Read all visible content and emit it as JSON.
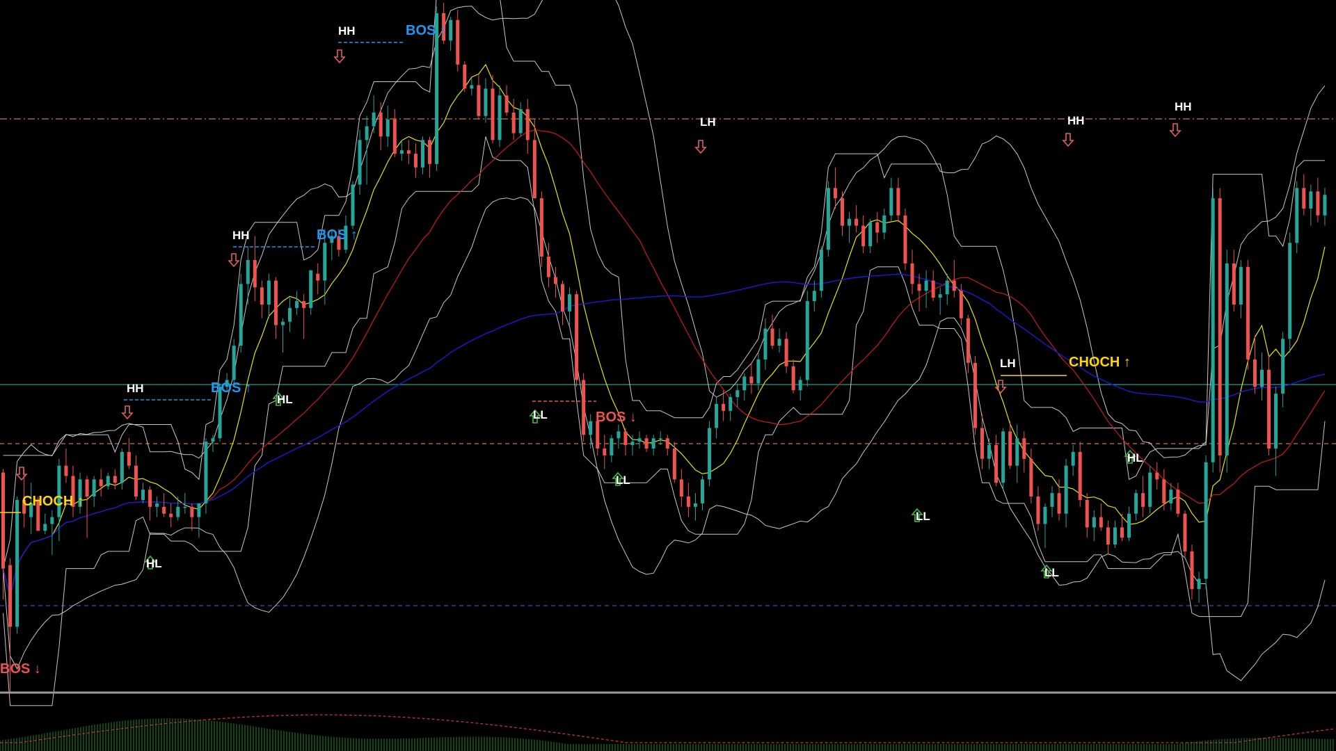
{
  "colors": {
    "background": "#000000",
    "bull": "#26a69a",
    "bear": "#ef5350",
    "bos_up": "#2196f3",
    "bos_down": "#ef5350",
    "choch": "#ffd600",
    "swing_label": "#ffffff",
    "bb": "#c8c8c8",
    "ma_fast": "#e6e600",
    "ma_mid": "#d01818",
    "ma_slow": "#1a1ad8",
    "hl_teal": "#2a9a8a",
    "hl_orange": "#c8783c",
    "hl_blue": "#3c50b4",
    "arrow_down": "#e06060",
    "arrow_up": "#40c040",
    "osc_hist": "#1e8c1e",
    "osc_line": "#c83232",
    "separator": "#9a9a9a"
  },
  "chart_data": {
    "type": "candlestick",
    "main_panel": {
      "price_range": [
        0,
        100
      ],
      "bar_count": 190,
      "candles": [
        [
          65,
          66,
          28,
          37
        ],
        [
          38,
          40,
          1,
          20
        ],
        [
          20,
          58,
          18,
          57
        ],
        [
          57,
          66,
          49,
          53
        ],
        [
          52,
          62,
          47,
          56
        ],
        [
          57,
          58,
          48,
          48
        ],
        [
          48,
          53,
          47,
          50
        ],
        [
          50,
          54,
          41,
          52
        ],
        [
          52,
          69,
          45,
          67
        ],
        [
          67,
          72,
          62,
          64
        ],
        [
          64,
          67,
          52,
          55
        ],
        [
          55,
          65,
          53,
          63
        ],
        [
          63,
          64,
          46,
          58
        ],
        [
          58,
          64,
          55,
          63
        ],
        [
          63,
          66,
          58,
          61
        ],
        [
          61,
          65,
          60,
          64
        ],
        [
          64,
          66,
          60,
          62
        ],
        [
          62,
          72,
          60,
          71
        ],
        [
          71,
          75,
          66,
          67
        ],
        [
          67,
          70,
          57,
          58
        ],
        [
          57,
          62,
          56,
          60
        ],
        [
          60,
          61,
          51,
          55
        ],
        [
          55,
          58,
          52,
          56
        ],
        [
          55,
          59,
          52,
          53
        ],
        [
          53,
          56,
          49,
          52
        ],
        [
          52,
          58,
          51,
          55
        ],
        [
          55,
          59,
          53,
          55
        ],
        [
          55,
          56,
          48,
          52
        ],
        [
          52,
          56,
          46,
          56
        ],
        [
          56,
          75,
          53,
          74
        ],
        [
          74,
          76,
          71,
          75
        ],
        [
          75,
          91,
          74,
          90
        ],
        [
          90,
          94,
          89,
          92
        ],
        [
          92,
          104,
          90,
          102
        ],
        [
          102,
          123,
          100,
          120
        ],
        [
          120,
          131,
          114,
          127
        ],
        [
          127,
          134,
          115,
          119
        ],
        [
          119,
          121,
          110,
          114
        ],
        [
          114,
          123,
          110,
          121
        ],
        [
          121,
          122,
          104,
          108
        ],
        [
          108,
          110,
          100,
          109
        ],
        [
          109,
          116,
          106,
          113
        ],
        [
          113,
          118,
          111,
          115
        ],
        [
          115,
          117,
          104,
          113
        ],
        [
          113,
          124,
          111,
          124
        ],
        [
          123,
          126,
          117,
          121
        ],
        [
          121,
          136,
          114,
          132
        ],
        [
          132,
          136,
          127,
          134
        ],
        [
          134,
          136,
          128,
          130
        ],
        [
          130,
          140,
          129,
          137
        ],
        [
          137,
          150,
          136,
          149
        ],
        [
          149,
          165,
          146,
          162
        ],
        [
          162,
          169,
          149,
          166
        ],
        [
          166,
          175,
          164,
          170
        ],
        [
          170,
          173,
          159,
          163
        ],
        [
          163,
          172,
          160,
          168
        ],
        [
          168,
          171,
          157,
          158
        ],
        [
          158,
          162,
          156,
          159
        ],
        [
          159,
          162,
          155,
          158
        ],
        [
          158,
          161,
          151,
          154
        ],
        [
          154,
          163,
          152,
          162
        ],
        [
          162,
          163,
          151,
          155
        ],
        [
          155,
          201,
          153,
          199
        ],
        [
          199,
          202,
          190,
          191
        ],
        [
          191,
          198,
          188,
          197
        ],
        [
          197,
          200,
          182,
          184
        ],
        [
          184,
          185,
          176,
          177
        ],
        [
          177,
          180,
          175,
          178
        ],
        [
          178,
          181,
          168,
          169
        ],
        [
          169,
          180,
          167,
          177
        ],
        [
          177,
          181,
          161,
          162
        ],
        [
          162,
          178,
          160,
          175
        ],
        [
          175,
          178,
          169,
          170
        ],
        [
          170,
          174,
          162,
          164
        ],
        [
          164,
          173,
          163,
          171
        ],
        [
          171,
          174,
          158,
          162
        ],
        [
          162,
          168,
          145,
          145
        ],
        [
          145,
          147,
          125,
          128
        ],
        [
          128,
          132,
          119,
          122
        ],
        [
          122,
          125,
          116,
          120
        ],
        [
          120,
          121,
          108,
          112
        ],
        [
          112,
          119,
          108,
          117
        ],
        [
          117,
          118,
          90,
          92
        ],
        [
          92,
          94,
          74,
          76
        ],
        [
          76,
          82,
          72,
          80
        ],
        [
          80,
          82,
          70,
          72
        ],
        [
          72,
          76,
          66,
          70
        ],
        [
          70,
          76,
          68,
          75
        ],
        [
          75,
          79,
          72,
          77
        ],
        [
          77,
          78,
          70,
          73
        ],
        [
          73,
          76,
          70,
          74
        ],
        [
          74,
          77,
          72,
          75
        ],
        [
          75,
          76,
          71,
          72
        ],
        [
          72,
          76,
          70,
          75
        ],
        [
          75,
          77,
          73,
          75
        ],
        [
          75,
          76,
          70,
          72
        ],
        [
          72,
          74,
          62,
          63
        ],
        [
          63,
          66,
          55,
          58
        ],
        [
          58,
          62,
          52,
          55
        ],
        [
          55,
          59,
          51,
          56
        ],
        [
          56,
          64,
          54,
          63
        ],
        [
          63,
          80,
          61,
          78
        ],
        [
          78,
          87,
          75,
          85
        ],
        [
          85,
          89,
          80,
          83
        ],
        [
          83,
          88,
          80,
          87
        ],
        [
          87,
          91,
          84,
          89
        ],
        [
          89,
          94,
          86,
          93
        ],
        [
          93,
          97,
          88,
          91
        ],
        [
          91,
          100,
          89,
          98
        ],
        [
          98,
          110,
          95,
          107
        ],
        [
          107,
          111,
          101,
          102
        ],
        [
          102,
          107,
          100,
          104
        ],
        [
          104,
          106,
          94,
          96
        ],
        [
          96,
          98,
          88,
          89
        ],
        [
          89,
          93,
          86,
          92
        ],
        [
          92,
          118,
          90,
          115
        ],
        [
          115,
          121,
          112,
          118
        ],
        [
          118,
          131,
          116,
          130
        ],
        [
          130,
          150,
          128,
          148
        ],
        [
          148,
          154,
          142,
          145
        ],
        [
          145,
          147,
          134,
          137
        ],
        [
          137,
          141,
          132,
          139
        ],
        [
          139,
          143,
          135,
          137
        ],
        [
          137,
          140,
          129,
          131
        ],
        [
          131,
          139,
          129,
          138
        ],
        [
          138,
          141,
          132,
          135
        ],
        [
          135,
          142,
          133,
          140
        ],
        [
          140,
          151,
          138,
          148
        ],
        [
          148,
          151,
          138,
          140
        ],
        [
          140,
          142,
          124,
          126
        ],
        [
          126,
          130,
          117,
          120
        ],
        [
          120,
          123,
          112,
          118
        ],
        [
          118,
          124,
          113,
          121
        ],
        [
          121,
          124,
          115,
          116
        ],
        [
          116,
          119,
          111,
          117
        ],
        [
          117,
          123,
          114,
          121
        ],
        [
          121,
          127,
          116,
          118
        ],
        [
          118,
          120,
          108,
          110
        ],
        [
          110,
          111,
          94,
          97
        ],
        [
          97,
          99,
          76,
          78
        ],
        [
          78,
          82,
          66,
          69
        ],
        [
          69,
          75,
          66,
          73
        ],
        [
          73,
          76,
          61,
          62
        ],
        [
          62,
          78,
          60,
          77
        ],
        [
          77,
          80,
          66,
          67
        ],
        [
          67,
          79,
          62,
          75
        ],
        [
          75,
          77,
          65,
          69
        ],
        [
          69,
          72,
          56,
          58
        ],
        [
          58,
          61,
          48,
          50
        ],
        [
          50,
          56,
          43,
          55
        ],
        [
          55,
          61,
          52,
          59
        ],
        [
          59,
          63,
          51,
          53
        ],
        [
          53,
          69,
          49,
          67
        ],
        [
          67,
          73,
          64,
          71
        ],
        [
          71,
          74,
          55,
          57
        ],
        [
          57,
          59,
          46,
          49
        ],
        [
          49,
          54,
          45,
          52
        ],
        [
          52,
          56,
          48,
          49
        ],
        [
          49,
          51,
          41,
          44
        ],
        [
          44,
          51,
          43,
          49
        ],
        [
          49,
          53,
          45,
          46
        ],
        [
          46,
          55,
          45,
          53
        ],
        [
          53,
          60,
          51,
          59
        ],
        [
          59,
          64,
          52,
          55
        ],
        [
          55,
          67,
          53,
          65
        ],
        [
          65,
          68,
          60,
          63
        ],
        [
          63,
          66,
          54,
          56
        ],
        [
          56,
          62,
          54,
          60
        ],
        [
          60,
          62,
          52,
          53
        ],
        [
          53,
          54,
          40,
          42
        ],
        [
          42,
          44,
          28,
          31
        ],
        [
          31,
          36,
          27,
          34
        ],
        [
          34,
          70,
          31,
          68
        ],
        [
          68,
          148,
          65,
          145
        ],
        [
          145,
          148,
          65,
          70
        ],
        [
          70,
          130,
          65,
          126
        ],
        [
          126,
          130,
          112,
          114
        ],
        [
          114,
          127,
          110,
          125
        ],
        [
          125,
          127,
          95,
          98
        ],
        [
          98,
          105,
          88,
          90
        ],
        [
          90,
          100,
          86,
          95
        ],
        [
          95,
          99,
          70,
          72
        ],
        [
          72,
          90,
          64,
          88
        ],
        [
          88,
          106,
          84,
          104
        ],
        [
          104,
          135,
          100,
          132
        ],
        [
          132,
          150,
          129,
          148
        ],
        [
          148,
          152,
          140,
          142
        ],
        [
          142,
          149,
          137,
          147
        ],
        [
          147,
          151,
          138,
          140
        ],
        [
          140,
          148,
          137,
          146
        ]
      ]
    },
    "structure_labels": [
      {
        "text": "BOS ↓",
        "kind": "bos_down"
      },
      {
        "text": "CHOCH ↑",
        "kind": "choch"
      },
      {
        "text": "HL",
        "kind": "swing"
      },
      {
        "text": "HH",
        "kind": "swing"
      },
      {
        "text": "BOS ↑",
        "kind": "bos_up"
      },
      {
        "text": "HL",
        "kind": "swing"
      },
      {
        "text": "HH",
        "kind": "swing"
      },
      {
        "text": "BOS ↑",
        "kind": "bos_up"
      },
      {
        "text": "HH",
        "kind": "swing"
      },
      {
        "text": "BOS ↑",
        "kind": "bos_up"
      },
      {
        "text": "LL",
        "kind": "swing"
      },
      {
        "text": "BOS ↓",
        "kind": "bos_down"
      },
      {
        "text": "LL",
        "kind": "swing"
      },
      {
        "text": "LH",
        "kind": "swing"
      },
      {
        "text": "LL",
        "kind": "swing"
      },
      {
        "text": "LH",
        "kind": "swing"
      },
      {
        "text": "LL",
        "kind": "swing"
      },
      {
        "text": "HH",
        "kind": "swing"
      },
      {
        "text": "CHOCH ↑",
        "kind": "choch"
      },
      {
        "text": "HL",
        "kind": "swing"
      },
      {
        "text": "HH",
        "kind": "swing"
      }
    ],
    "horizontal_levels": [
      {
        "kind": "orange_dashdot"
      },
      {
        "kind": "teal_solid"
      },
      {
        "kind": "orange_dashed"
      },
      {
        "kind": "blue_dashed"
      }
    ],
    "oscillator_panel": {
      "histogram_peak": 1.0,
      "signal_line": true
    }
  }
}
